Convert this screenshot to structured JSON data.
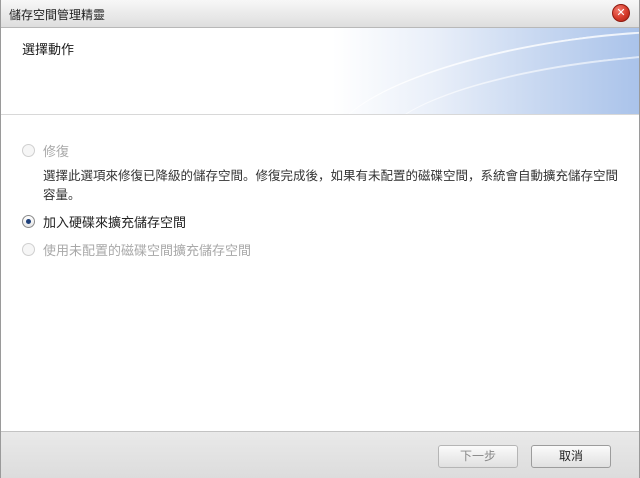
{
  "window": {
    "title": "儲存空間管理精靈",
    "close_icon": "close-icon",
    "accent_close": "#d63a2a"
  },
  "header": {
    "title": "選擇動作"
  },
  "options": [
    {
      "label": "修復",
      "selected": false,
      "enabled": false,
      "description": "選擇此選項來修復已降級的儲存空間。修復完成後，如果有未配置的磁碟空間，系統會自動擴充儲存空間容量。"
    },
    {
      "label": "加入硬碟來擴充儲存空間",
      "selected": true,
      "enabled": true
    },
    {
      "label": "使用未配置的磁碟空間擴充儲存空間",
      "selected": false,
      "enabled": false
    }
  ],
  "footer": {
    "next_label": "下一步",
    "cancel_label": "取消"
  }
}
